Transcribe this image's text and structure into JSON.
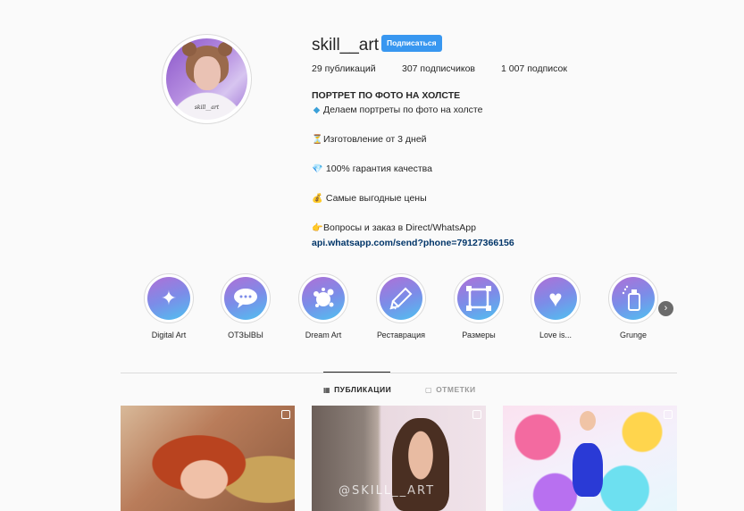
{
  "profile": {
    "username": "skill__art",
    "follow_label": "Подписаться",
    "avatar_caption": "skill__art",
    "stats": {
      "posts": "29 публикаций",
      "followers": "307 подписчиков",
      "following": "1 007 подписок"
    },
    "bio": {
      "title": "ПОРТРЕТ ПО ФОТО НА ХОЛСТЕ",
      "lines": [
        {
          "icon": "◆",
          "icon_name": "diamond-icon",
          "text": "Делаем портреты по фото на холсте"
        },
        {
          "icon": "⏳",
          "icon_name": "hourglass-icon",
          "text": "Изготовление от 3 дней"
        },
        {
          "icon": "💎",
          "icon_name": "gem-icon",
          "text": " 100% гарантия качества"
        },
        {
          "icon": "💰",
          "icon_name": "money-bag-icon",
          "text": " Самые выгодные цены"
        },
        {
          "icon": "👉",
          "icon_name": "pointing-hand-icon",
          "text": "Вопросы и заказ в Direct/WhatsApp"
        }
      ],
      "link": "api.whatsapp.com/send?phone=79127366156"
    }
  },
  "highlights": [
    {
      "label": "Digital Art",
      "icon": "✦",
      "icon_name": "sparkles-icon"
    },
    {
      "label": "ОТЗЫВЫ",
      "icon": "💬",
      "icon_name": "chat-bubble-icon"
    },
    {
      "label": "Dream Art",
      "icon": "✺",
      "icon_name": "paint-splash-icon"
    },
    {
      "label": "Реставрация",
      "icon": "✎",
      "icon_name": "pencil-icon"
    },
    {
      "label": "Размеры",
      "icon": "▣",
      "icon_name": "frame-icon"
    },
    {
      "label": "Love is...",
      "icon": "♥",
      "icon_name": "hearts-icon"
    },
    {
      "label": "Grunge",
      "icon": "▮",
      "icon_name": "spray-can-icon"
    }
  ],
  "tabs": [
    {
      "label": "ПУБЛИКАЦИИ",
      "icon": "▦",
      "icon_name": "grid-icon",
      "active": true
    },
    {
      "label": "ОТМЕТКИ",
      "icon": "▢",
      "icon_name": "tagged-icon",
      "active": false
    }
  ],
  "posts": [
    {
      "name": "post-portrait-red-hair"
    },
    {
      "name": "post-portrait-brunette",
      "watermark": "@SKILL__ART"
    },
    {
      "name": "post-figure-skater"
    }
  ],
  "colors": {
    "accent": "#3897f0",
    "link": "#003569",
    "background": "#fafafa",
    "highlight_gradient": [
      "#b06fd6",
      "#7c8ce8",
      "#4fc1f0"
    ]
  }
}
